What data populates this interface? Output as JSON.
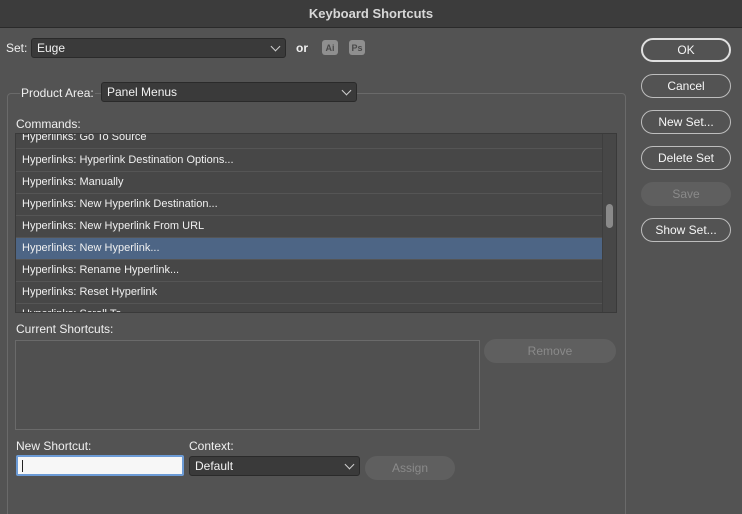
{
  "window": {
    "title": "Keyboard Shortcuts"
  },
  "set": {
    "label": "Set:",
    "value": "Euge",
    "or_label": "or",
    "ai_icon": "Ai",
    "ps_icon": "Ps"
  },
  "product_area": {
    "label": "Product Area:",
    "value": "Panel Menus"
  },
  "commands": {
    "label": "Commands:",
    "items": [
      "Hyperlinks: Go To Source",
      "Hyperlinks: Hyperlink Destination Options...",
      "Hyperlinks: Manually",
      "Hyperlinks: New Hyperlink Destination...",
      "Hyperlinks: New Hyperlink From URL",
      "Hyperlinks: New Hyperlink...",
      "Hyperlinks: Rename Hyperlink...",
      "Hyperlinks: Reset Hyperlink",
      "Hyperlinks: Scroll To ..."
    ],
    "selected_index": 5
  },
  "current_shortcuts": {
    "label": "Current Shortcuts:",
    "remove_label": "Remove"
  },
  "new_shortcut": {
    "label": "New Shortcut:",
    "value": ""
  },
  "context": {
    "label": "Context:",
    "value": "Default"
  },
  "assign_label": "Assign",
  "buttons": {
    "ok": "OK",
    "cancel": "Cancel",
    "new_set": "New Set...",
    "delete_set": "Delete Set",
    "save": "Save",
    "show_set": "Show Set..."
  }
}
